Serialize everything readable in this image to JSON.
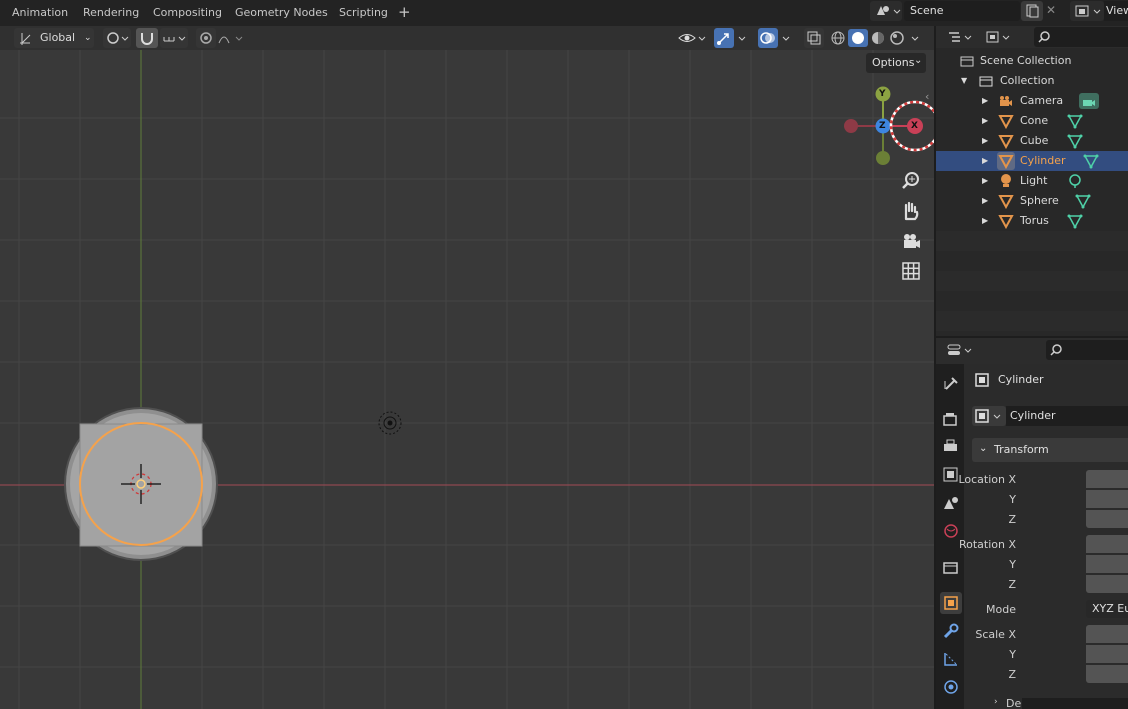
{
  "workspace_tabs": [
    "Animation",
    "Rendering",
    "Compositing",
    "Geometry Nodes",
    "Scripting"
  ],
  "add_tab_symbol": "+",
  "scene": {
    "name": "Scene",
    "view_layer_label": "View"
  },
  "viewport": {
    "orientation": "Global",
    "options_label": "Options",
    "gizmo": {
      "x": "X",
      "y": "Y",
      "z": "Z"
    },
    "colors": {
      "x_axis": "#c94057",
      "y_axis": "#8ca342",
      "z_axis": "#3d86e0",
      "selection": "#f5a24b",
      "background": "#393939"
    }
  },
  "outliner": {
    "root": "Scene Collection",
    "collection": "Collection",
    "items": [
      {
        "name": "Camera",
        "type": "camera",
        "selected": false
      },
      {
        "name": "Cone",
        "type": "mesh",
        "selected": false
      },
      {
        "name": "Cube",
        "type": "mesh",
        "selected": false
      },
      {
        "name": "Cylinder",
        "type": "mesh",
        "selected": true
      },
      {
        "name": "Light",
        "type": "light",
        "selected": false
      },
      {
        "name": "Sphere",
        "type": "mesh",
        "selected": false
      },
      {
        "name": "Torus",
        "type": "mesh",
        "selected": false
      }
    ]
  },
  "properties": {
    "object_name": "Cylinder",
    "datablock_name": "Cylinder",
    "transform_label": "Transform",
    "location_x": "Location X",
    "rotation_x": "Rotation X",
    "scale_x": "Scale X",
    "y_label": "Y",
    "z_label": "Z",
    "mode_label": "Mode",
    "mode_value": "XYZ Eu",
    "delta_label": "De"
  }
}
